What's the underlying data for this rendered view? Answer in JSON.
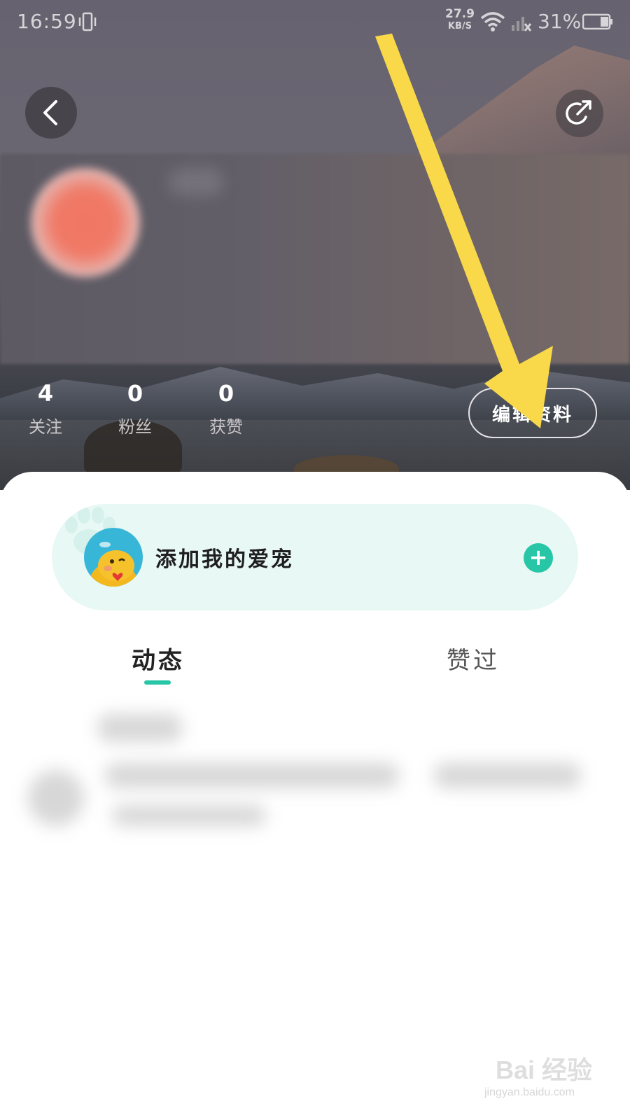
{
  "status_bar": {
    "time": "16:59",
    "net_speed_value": "27.9",
    "net_speed_unit": "KB/S",
    "battery_percent": "31%"
  },
  "profile": {
    "stats": [
      {
        "value": "4",
        "label": "关注"
      },
      {
        "value": "0",
        "label": "粉丝"
      },
      {
        "value": "0",
        "label": "获赞"
      }
    ],
    "edit_button_label": "编辑资料"
  },
  "pet_card": {
    "label": "添加我的爱宠",
    "add_icon": "+"
  },
  "tabs": [
    {
      "label": "动态",
      "active": true
    },
    {
      "label": "赞过",
      "active": false
    }
  ],
  "watermark": {
    "brand": "Bai 经验",
    "url": "jingyan.baidu.com"
  },
  "colors": {
    "accent": "#26c6a6",
    "pet_card_bg": "#e8f8f4",
    "annotation_arrow": "#f9d94a"
  }
}
